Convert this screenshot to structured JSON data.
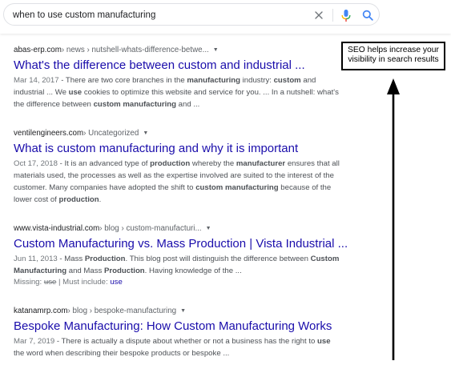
{
  "search": {
    "query": "when to use custom manufacturing"
  },
  "icons": {
    "clear": "close-icon",
    "mic": "microphone-icon",
    "search": "search-icon",
    "caret": "caret-down-icon"
  },
  "colors": {
    "link": "#1a0dab",
    "snippet": "#4d5156",
    "meta": "#70757a",
    "mic_blue": "#4285f4",
    "mic_red": "#ea4335",
    "mic_yellow": "#fbbc05",
    "mic_green": "#34a853"
  },
  "results": [
    {
      "site": "abas-erp.com",
      "path": " › news › nutshell-whats-difference-betwe...",
      "title": "What's the difference between custom and industrial ...",
      "date": "Mar 14, 2017",
      "snippet": [
        {
          "t": " - There are two core branches in the ",
          "b": false
        },
        {
          "t": "manufacturing",
          "b": true
        },
        {
          "t": " industry: ",
          "b": false
        },
        {
          "t": "custom",
          "b": true
        },
        {
          "t": " and industrial ... We ",
          "b": false
        },
        {
          "t": "use",
          "b": true
        },
        {
          "t": " cookies to optimize this website and service for you. ... In a nutshell: what's the difference between ",
          "b": false
        },
        {
          "t": "custom manufacturing",
          "b": true
        },
        {
          "t": " and ...",
          "b": false
        }
      ]
    },
    {
      "site": "ventilengineers.com",
      "path": " › Uncategorized",
      "title": "What is custom manufacturing and why it is important",
      "date": "Oct 17, 2018",
      "snippet": [
        {
          "t": " - It is an advanced type of ",
          "b": false
        },
        {
          "t": "production",
          "b": true
        },
        {
          "t": " whereby the ",
          "b": false
        },
        {
          "t": "manufacturer",
          "b": true
        },
        {
          "t": " ensures that all materials used, the processes as well as the expertise involved are suited to the interest of the customer. Many companies have adopted the shift to ",
          "b": false
        },
        {
          "t": "custom manufacturing",
          "b": true
        },
        {
          "t": " because of the lower cost of ",
          "b": false
        },
        {
          "t": "production",
          "b": true
        },
        {
          "t": ".",
          "b": false
        }
      ]
    },
    {
      "site": "www.vista-industrial.com",
      "path": " › blog › custom-manufacturi...",
      "title": "Custom Manufacturing vs. Mass Production | Vista Industrial ...",
      "date": "Jun 11, 2013",
      "snippet": [
        {
          "t": " - Mass ",
          "b": false
        },
        {
          "t": "Production",
          "b": true
        },
        {
          "t": ". This blog post will distinguish the difference between ",
          "b": false
        },
        {
          "t": "Custom Manufacturing",
          "b": true
        },
        {
          "t": " and Mass ",
          "b": false
        },
        {
          "t": "Production",
          "b": true
        },
        {
          "t": ". Having knowledge of the ...",
          "b": false
        }
      ],
      "missing": {
        "prefix": "Missing: ",
        "struck": "use",
        "middle": " | Must include: ",
        "link": "use"
      }
    },
    {
      "site": "katanamrp.com",
      "path": " › blog › bespoke-manufacturing",
      "title": "Bespoke Manufacturing: How Custom Manufacturing Works",
      "date": "Mar 7, 2019",
      "snippet": [
        {
          "t": " - There is actually a dispute about whether or not a business has the right to ",
          "b": false
        },
        {
          "t": "use",
          "b": true
        },
        {
          "t": " the word when describing their bespoke products or bespoke ...",
          "b": false
        }
      ]
    }
  ],
  "annotation": {
    "text": "SEO helps increase your visibility in search results"
  }
}
